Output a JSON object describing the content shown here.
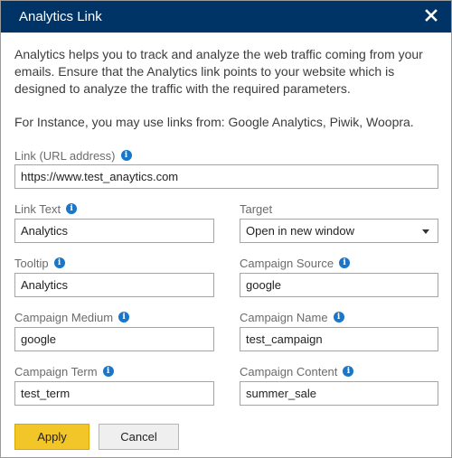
{
  "dialog": {
    "title": "Analytics Link",
    "close_icon": "close-icon"
  },
  "description": {
    "paragraph1": "Analytics helps you to track and analyze the web traffic coming from your emails. Ensure that the Analytics link points to your website which is designed to analyze the traffic with the required parameters.",
    "paragraph2": "For Instance, you may use links from: Google Analytics, Piwik, Woopra."
  },
  "fields": {
    "link": {
      "label": "Link (URL address)",
      "value": "https://www.test_anaytics.com"
    },
    "link_text": {
      "label": "Link Text",
      "value": "Analytics"
    },
    "target": {
      "label": "Target",
      "value": "Open in new window"
    },
    "tooltip": {
      "label": "Tooltip",
      "value": "Analytics"
    },
    "campaign_source": {
      "label": "Campaign Source",
      "value": "google"
    },
    "campaign_medium": {
      "label": "Campaign Medium",
      "value": "google"
    },
    "campaign_name": {
      "label": "Campaign Name",
      "value": "test_campaign"
    },
    "campaign_term": {
      "label": "Campaign Term",
      "value": "test_term"
    },
    "campaign_content": {
      "label": "Campaign Content",
      "value": "summer_sale"
    }
  },
  "info_icon_glyph": "i",
  "buttons": {
    "apply": "Apply",
    "cancel": "Cancel"
  },
  "colors": {
    "titlebar": "#003466",
    "info_icon": "#1976c8",
    "apply_button": "#f2c529"
  }
}
